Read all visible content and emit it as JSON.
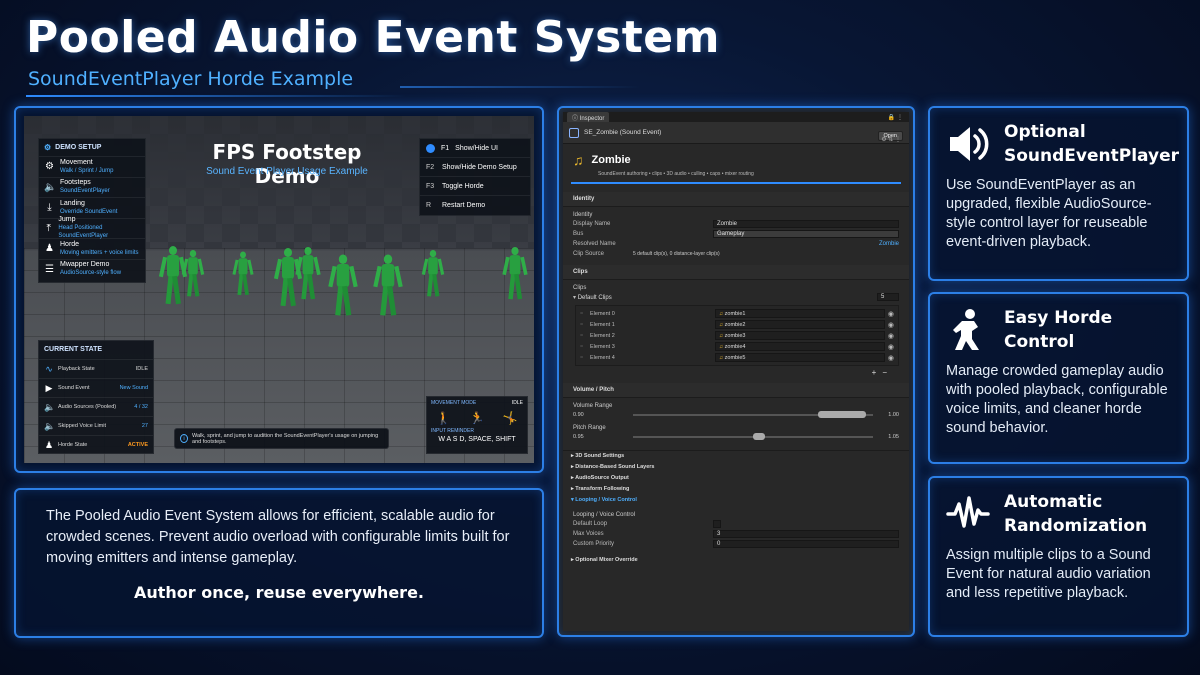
{
  "header": {
    "title": "Pooled Audio Event System",
    "subtitle": "SoundEventPlayer Horde Example"
  },
  "game_view": {
    "demo_title": "FPS Footstep Demo",
    "demo_subtitle": "Sound Event Player Usage Example",
    "setup": {
      "heading": "DEMO SETUP",
      "items": [
        {
          "icon": "walk-icon",
          "title": "Movement",
          "desc": "Walk / Sprint / Jump"
        },
        {
          "icon": "speaker-icon",
          "title": "Footsteps",
          "desc": "SoundEventPlayer"
        },
        {
          "icon": "landing-icon",
          "title": "Landing",
          "desc": "Override SoundEvent"
        },
        {
          "icon": "jump-icon",
          "title": "Jump",
          "desc": "Head Positioned SoundEventPlayer"
        },
        {
          "icon": "horde-icon",
          "title": "Horde",
          "desc": "Moving emitters + voice limits"
        },
        {
          "icon": "mixer-icon",
          "title": "Mwapper Demo",
          "desc": "AudioSource-style flow"
        }
      ]
    },
    "keys": [
      {
        "key": "F1",
        "label": "Show/Hide UI"
      },
      {
        "key": "F2",
        "label": "Show/Hide Demo Setup"
      },
      {
        "key": "F3",
        "label": "Toggle Horde"
      },
      {
        "key": "R",
        "label": "Restart Demo"
      }
    ],
    "state": {
      "heading": "CURRENT STATE",
      "rows": [
        {
          "icon": "waveform-icon",
          "label": "Playback State",
          "value": "IDLE"
        },
        {
          "icon": "play-icon",
          "label": "Sound Event",
          "value": "New Sound"
        },
        {
          "icon": "speaker-icon",
          "label": "Audio Sources (Pooled)",
          "value": "4 / 32"
        },
        {
          "icon": "speaker-icon",
          "label": "Skipped Voice Limit",
          "value": "27"
        },
        {
          "icon": "horde-icon",
          "label": "Horde State",
          "value": "ACTIVE"
        }
      ],
      "active_color": "#ff9a1f"
    },
    "movement": {
      "heading": "MOVEMENT MODE",
      "mode": "IDLE",
      "reminder_label": "INPUT REMINDER",
      "keys": "W A S D, SPACE, SHIFT"
    },
    "hint": "Walk, sprint, and jump to audition the SoundEventPlayer's usage on jumping and footsteps."
  },
  "description": {
    "body": "The Pooled Audio Event System allows for efficient, scalable audio for crowded scenes. Prevent audio overload with configurable limits built for moving emitters and intense gameplay.",
    "tagline": "Author once, reuse everywhere."
  },
  "inspector": {
    "tab": "Inspector",
    "asset_title": "SE_Zombie (Sound Event)",
    "open_label": "Open",
    "name": "Zombie",
    "summary": "SoundEvent authoring • clips • 3D audio • culling • caps • mixer routing",
    "identity": {
      "section": "Identity",
      "sub": "Identity",
      "display_name_label": "Display Name",
      "display_name": "Zombie",
      "bus_label": "Bus",
      "bus": "Gameplay",
      "resolved_label": "Resolved Name",
      "resolved": "Zombie",
      "clip_source_label": "Clip Source",
      "clip_source": "5 default clip(s), 0 distance-layer clip(s)"
    },
    "clips": {
      "section": "Clips",
      "sub": "Clips",
      "default_label": "Default Clips",
      "count": "5",
      "elements": [
        {
          "label": "Element 0",
          "value": "zombie1"
        },
        {
          "label": "Element 1",
          "value": "zombie2"
        },
        {
          "label": "Element 2",
          "value": "zombie3"
        },
        {
          "label": "Element 3",
          "value": "zombie4"
        },
        {
          "label": "Element 4",
          "value": "zombie5"
        }
      ]
    },
    "volume": {
      "section": "Volume / Pitch",
      "volume_label": "Volume Range",
      "volume_min": "0.90",
      "volume_max": "1.00",
      "pitch_label": "Pitch Range",
      "pitch_min": "0.95",
      "pitch_max": "1.05"
    },
    "folds": [
      "3D Sound Settings",
      "Distance-Based Sound Layers",
      "AudioSource Output",
      "Transform Following"
    ],
    "looping": {
      "section": "Looping / Voice Control",
      "sub": "Looping / Voice Control",
      "default_loop_label": "Default Loop",
      "max_voices_label": "Max Voices",
      "max_voices": "3",
      "custom_priority_label": "Custom Priority",
      "custom_priority": "0"
    },
    "mixer_fold": "Optional Mixer Override"
  },
  "cards": [
    {
      "icon": "speaker-icon",
      "title_line1": "Optional",
      "title_line2": "SoundEventPlayer",
      "body": "Use SoundEventPlayer as an upgraded, flexible AudioSource-style control layer for reuseable event-driven playback."
    },
    {
      "icon": "horde-icon",
      "title_line1": "Easy Horde",
      "title_line2": "Control",
      "body": "Manage crowded gameplay audio with pooled playback, configurable voice limits, and cleaner horde sound behavior."
    },
    {
      "icon": "waveform-icon",
      "title_line1": "Automatic",
      "title_line2": "Randomization",
      "body": "Assign multiple clips to a Sound Event for natural audio variation and less repetitive playback."
    }
  ],
  "colors": {
    "accent": "#2f8cff",
    "accent_text": "#4fb0ff",
    "clip_icon": "#e8b62c"
  }
}
